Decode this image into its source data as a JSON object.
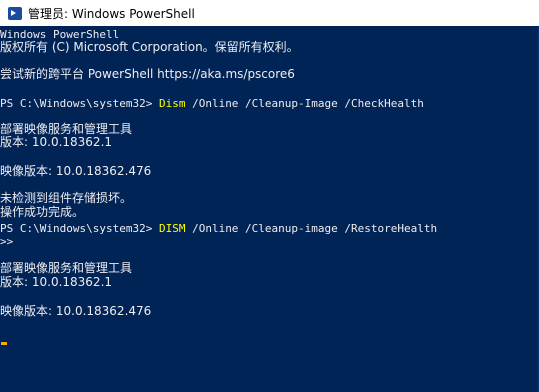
{
  "window": {
    "title": "管理员: Windows PowerShell",
    "icon": "powershell-icon"
  },
  "console": {
    "banner1": "Windows PowerShell",
    "banner2": "版权所有 (C) Microsoft Corporation。保留所有权利。",
    "banner3": "尝试新的跨平台 PowerShell https://aka.ms/pscore6",
    "prompt": "PS C:\\Windows\\system32> ",
    "cmd1_name": "Dism",
    "cmd1_args": " /Online /Cleanup-Image /CheckHealth",
    "tool_name": "部署映像服务和管理工具",
    "version_line": "版本: 10.0.18362.1",
    "image_version_line": "映像版本: 10.0.18362.476",
    "no_corruption": "未检测到组件存储损坏。",
    "success": "操作成功完成。",
    "cmd2_name": "DISM",
    "cmd2_args": " /Online /Cleanup-image /RestoreHealth",
    "continuation": ">>",
    "tool_name_2": "部署映像服务和管理工具",
    "version_line_2": "版本: 10.0.18362.1",
    "image_version_line_2": "映像版本: 10.0.18362.476"
  },
  "colors": {
    "background": "#012456",
    "text": "#eeedf0",
    "command": "#ffff00",
    "cursor": "#f2a900"
  }
}
